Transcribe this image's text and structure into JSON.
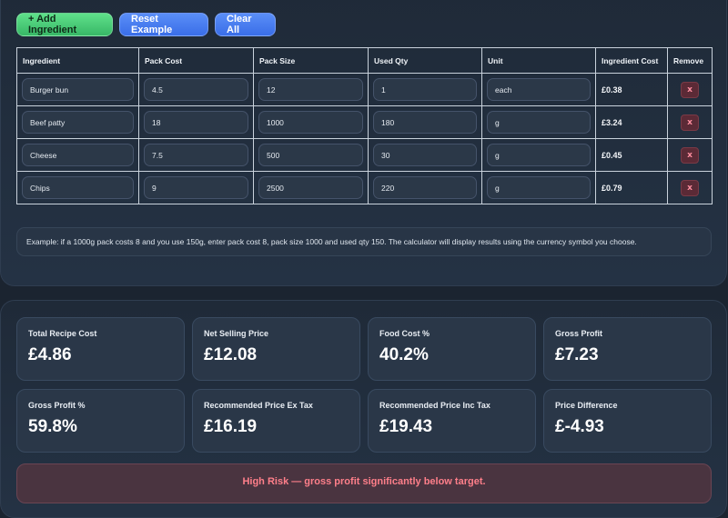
{
  "toolbar": {
    "add_label": "+ Add Ingredient",
    "reset_label": "Reset Example",
    "clear_label": "Clear All"
  },
  "table": {
    "headers": [
      "Ingredient",
      "Pack Cost",
      "Pack Size",
      "Used Qty",
      "Unit",
      "Ingredient Cost",
      "Remove"
    ],
    "rows": [
      {
        "ingredient": "Burger bun",
        "pack_cost": "4.5",
        "pack_size": "12",
        "used_qty": "1",
        "unit": "each",
        "cost": "£0.38",
        "remove": "x"
      },
      {
        "ingredient": "Beef patty",
        "pack_cost": "18",
        "pack_size": "1000",
        "used_qty": "180",
        "unit": "g",
        "cost": "£3.24",
        "remove": "x"
      },
      {
        "ingredient": "Cheese",
        "pack_cost": "7.5",
        "pack_size": "500",
        "used_qty": "30",
        "unit": "g",
        "cost": "£0.45",
        "remove": "x"
      },
      {
        "ingredient": "Chips",
        "pack_cost": "9",
        "pack_size": "2500",
        "used_qty": "220",
        "unit": "g",
        "cost": "£0.79",
        "remove": "x"
      }
    ]
  },
  "hint": "Example: if a 1000g pack costs 8 and you use 150g, enter pack cost 8, pack size 1000 and used qty 150. The calculator will display results using the currency symbol you choose.",
  "metrics": [
    {
      "label": "Total Recipe Cost",
      "value": "£4.86"
    },
    {
      "label": "Net Selling Price",
      "value": "£12.08"
    },
    {
      "label": "Food Cost %",
      "value": "40.2%"
    },
    {
      "label": "Gross Profit",
      "value": "£7.23"
    },
    {
      "label": "Gross Profit %",
      "value": "59.8%"
    },
    {
      "label": "Recommended Price Ex Tax",
      "value": "£16.19"
    },
    {
      "label": "Recommended Price Inc Tax",
      "value": "£19.43"
    },
    {
      "label": "Price Difference",
      "value": "£-4.93"
    }
  ],
  "risk": {
    "text": "High Risk — gross profit significantly below target.",
    "color": "#ff7f8a"
  },
  "colors": {
    "add_button": "#4fcf7a",
    "blue_button": "#4a7ff0",
    "background": "#1b2430"
  }
}
